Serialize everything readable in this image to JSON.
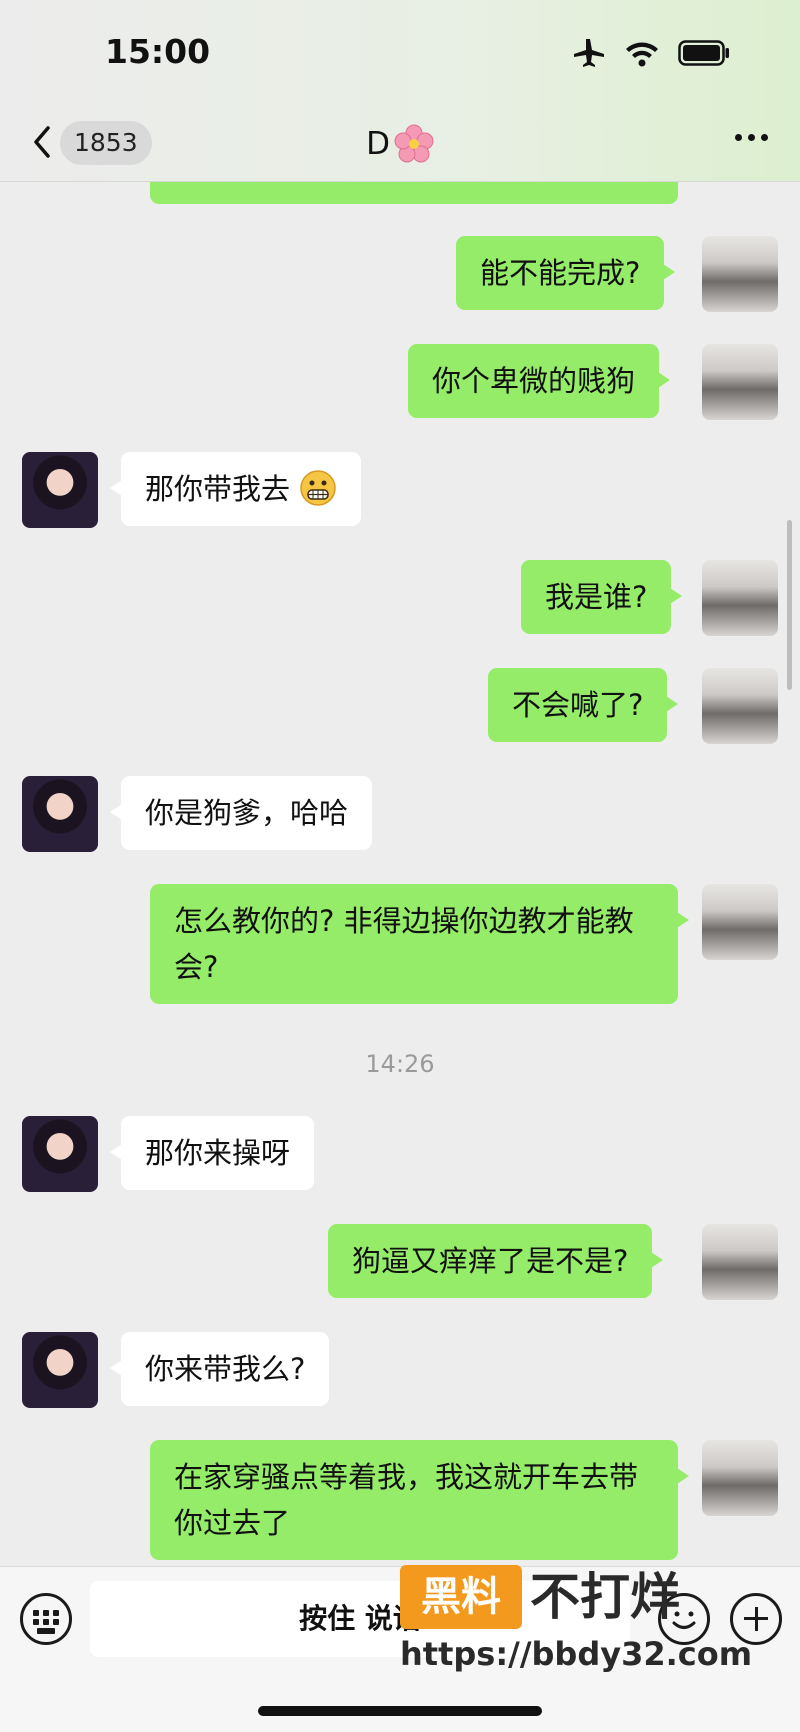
{
  "status_bar": {
    "time": "15:00"
  },
  "nav": {
    "unread_count": "1853",
    "title": "D",
    "title_icon": "cherry-blossom-emoji"
  },
  "messages": [
    {
      "side": "me",
      "text": "能不能完成?"
    },
    {
      "side": "me",
      "text": "你个卑微的贱狗"
    },
    {
      "side": "them",
      "text": "那你带我去",
      "emoji": "grimacing-face-emoji"
    },
    {
      "side": "me",
      "text": "我是谁?"
    },
    {
      "side": "me",
      "text": "不会喊了?"
    },
    {
      "side": "them",
      "text": "你是狗爹，哈哈"
    },
    {
      "side": "me",
      "text": "怎么教你的? 非得边操你边教才能教会?"
    },
    {
      "side": "them",
      "text": "那你来操呀"
    },
    {
      "side": "me",
      "text": "狗逼又痒痒了是不是?"
    },
    {
      "side": "them",
      "text": "你来带我么?"
    },
    {
      "side": "me",
      "text": "在家穿骚点等着我，我这就开车去带你过去了"
    }
  ],
  "timestamp": "14:26",
  "input_bar": {
    "hold_to_talk": "按住 说话"
  },
  "watermark": {
    "badge": "黑料",
    "text": "不打烊",
    "url": "https://bbdy32.com"
  },
  "colors": {
    "my_bubble": "#95ec69",
    "their_bubble": "#ffffff",
    "background": "#ededed"
  }
}
